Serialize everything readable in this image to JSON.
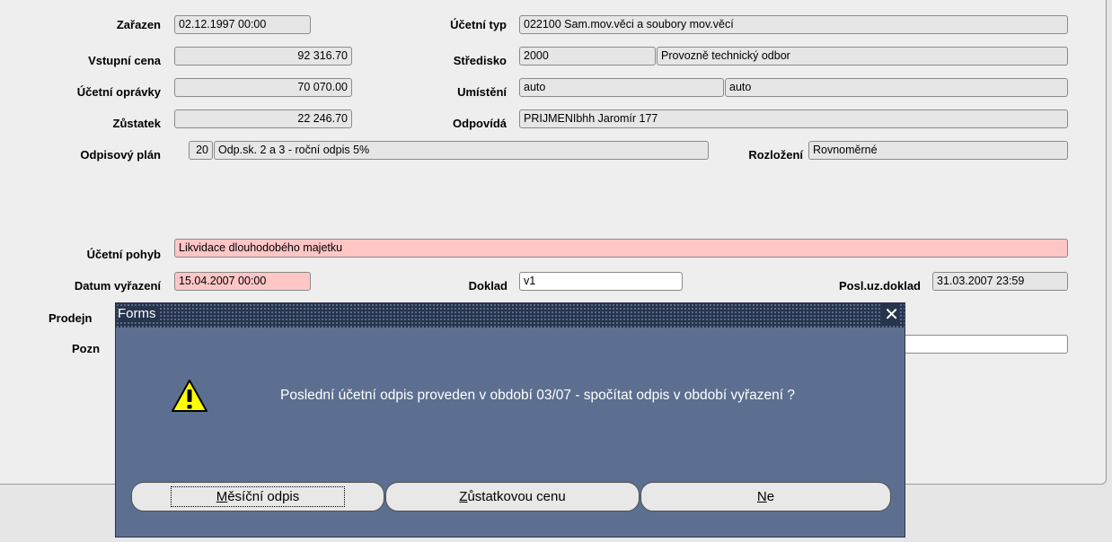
{
  "form": {
    "zarazen": {
      "label": "Zařazen",
      "value": "02.12.1997 00:00"
    },
    "vstupni_cena": {
      "label": "Vstupní cena",
      "value": "92 316.70"
    },
    "ucetni_opravky": {
      "label": "Účetní oprávky",
      "value": "70 070.00"
    },
    "zustatek": {
      "label": "Zůstatek",
      "value": "22 246.70"
    },
    "odpisovy_plan": {
      "label": "Odpisový plán",
      "code": "20",
      "value": "Odp.sk. 2 a 3 - roční odpis 5%"
    },
    "ucetni_typ": {
      "label": "Účetní typ",
      "value": "022100 Sam.mov.věci a soubory mov.věcí"
    },
    "stredisko": {
      "label": "Středisko",
      "code": "2000",
      "value": "Provozně technický odbor"
    },
    "umisteni": {
      "label": "Umístění",
      "value1": "auto",
      "value2": "auto"
    },
    "odpovida": {
      "label": "Odpovídá",
      "value": "PRIJMENIbhh Jaromír 177"
    },
    "rozlozeni": {
      "label": "Rozložení",
      "value": "Rovnoměrné"
    },
    "ucetni_pohyb": {
      "label": "Účetní pohyb",
      "value": "Likvidace dlouhodobého majetku"
    },
    "datum_vyrazeni": {
      "label": "Datum vyřazení",
      "value": "15.04.2007 00:00"
    },
    "doklad": {
      "label": "Doklad",
      "value": "v1"
    },
    "posl_uz_doklad": {
      "label": "Posl.uz.doklad",
      "value": "31.03.2007 23:59"
    },
    "prodejn": {
      "label": "Prodejn"
    },
    "pozn": {
      "label": "Pozn"
    }
  },
  "dialog": {
    "title": "Forms",
    "close_glyph": "✕",
    "icon": "warning-icon",
    "message": "Poslední účetní odpis proveden v období 03/07 - spočítat odpis v období vyřazení ?",
    "buttons": {
      "mesicni": {
        "mnemonic": "M",
        "rest": "ěsíční odpis"
      },
      "zustatkovou": {
        "mnemonic": "Z",
        "rest": "ůstatkovou cenu"
      },
      "ne": {
        "mnemonic": "N",
        "rest": "e"
      }
    }
  }
}
